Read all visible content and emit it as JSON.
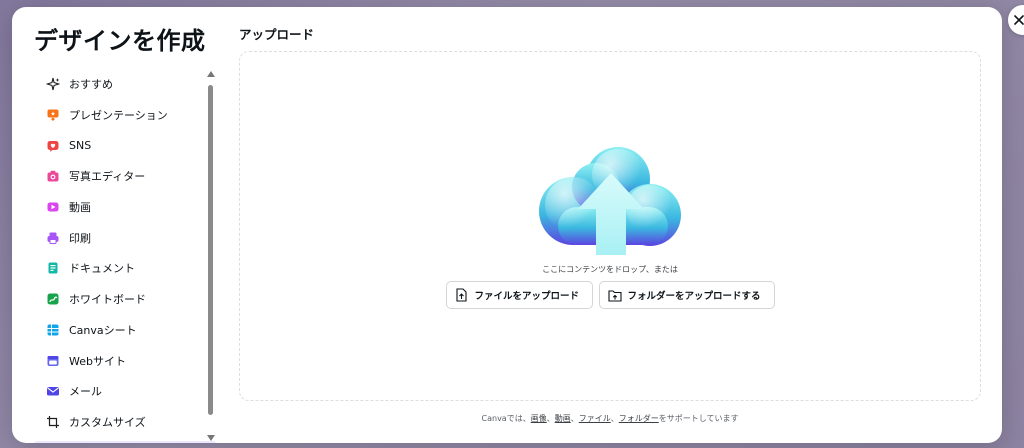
{
  "modal": {
    "title": "デザインを作成",
    "close_label": "×"
  },
  "sidebar": {
    "items": [
      {
        "label": "おすすめ",
        "icon": "sparkle-icon",
        "color": "#1f1f1f"
      },
      {
        "label": "プレゼンテーション",
        "icon": "presentation-icon",
        "color": "#f97316"
      },
      {
        "label": "SNS",
        "icon": "heart-icon",
        "color": "#ef4444"
      },
      {
        "label": "写真エディター",
        "icon": "camera-icon",
        "color": "#ec4899"
      },
      {
        "label": "動画",
        "icon": "video-icon",
        "color": "#d946ef"
      },
      {
        "label": "印刷",
        "icon": "printer-icon",
        "color": "#a855f7"
      },
      {
        "label": "ドキュメント",
        "icon": "document-icon",
        "color": "#14b8a6"
      },
      {
        "label": "ホワイトボード",
        "icon": "whiteboard-icon",
        "color": "#16a34a"
      },
      {
        "label": "Canvaシート",
        "icon": "sheet-icon",
        "color": "#0ea5e9"
      },
      {
        "label": "Webサイト",
        "icon": "website-icon",
        "color": "#6366f1"
      },
      {
        "label": "メール",
        "icon": "mail-icon",
        "color": "#4f46e5"
      },
      {
        "label": "カスタムサイズ",
        "icon": "custom-size-icon",
        "color": "#1f1f1f"
      }
    ]
  },
  "upload": {
    "section_title": "アップロード",
    "drop_hint": "ここにコンテンツをドロップ、または",
    "file_button": "ファイルをアップロード",
    "folder_button": "フォルダーをアップロードする"
  },
  "footer": {
    "prefix": "Canvaでは、",
    "link_image": "画像",
    "sep1": "、",
    "link_video": "動画",
    "sep2": "、",
    "link_file": "ファイル",
    "sep3": "、",
    "link_folder": "フォルダー",
    "suffix": "をサポートしています"
  },
  "colors": {
    "accent": "#7d2ae8",
    "cloud_top": "#7fe3ec",
    "cloud_bottom": "#5b4fe0"
  }
}
